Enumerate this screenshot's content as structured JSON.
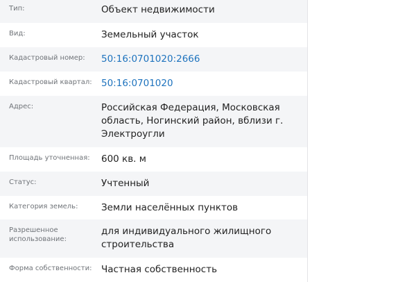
{
  "property": {
    "rows": [
      {
        "label": "Тип:",
        "value": "Объект недвижимости",
        "is_link": false
      },
      {
        "label": "Вид:",
        "value": "Земельный участок",
        "is_link": false
      },
      {
        "label": "Кадастровый номер:",
        "value": "50:16:0701020:2666",
        "is_link": true
      },
      {
        "label": "Кадастровый квартал:",
        "value": "50:16:0701020",
        "is_link": true
      },
      {
        "label": "Адрес:",
        "value": "Российская Федерация, Московская область, Ногинский район, вблизи г. Электроугли",
        "is_link": false
      },
      {
        "label": "Площадь уточненная:",
        "value": "600 кв. м",
        "is_link": false
      },
      {
        "label": "Статус:",
        "value": "Учтенный",
        "is_link": false
      },
      {
        "label": "Категория земель:",
        "value": "Земли населённых пунктов",
        "is_link": false
      },
      {
        "label": "Разрешенное использование:",
        "value": "для индивидуального жилищного строительства",
        "is_link": false
      },
      {
        "label": "Форма собственности:",
        "value": "Частная собственность",
        "is_link": false
      }
    ]
  },
  "colors": {
    "link": "#1e73be",
    "label": "#6f7378",
    "value": "#222222",
    "stripe": "#f4f5f7"
  }
}
